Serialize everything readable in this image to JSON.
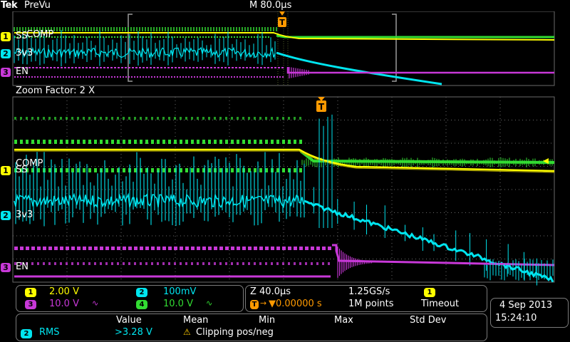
{
  "header": {
    "logo": "Tek",
    "mode": "PreVu",
    "timebase": "M 80.0µs"
  },
  "overview": {
    "channels": [
      {
        "badge": "1",
        "name": "SS",
        "color": "#ffff00"
      },
      {
        "badge": "2",
        "name": "3v3",
        "color": "#00e5ef"
      },
      {
        "badge": "3",
        "name": "EN",
        "color": "#c838d8"
      }
    ],
    "comp_label": "COMP"
  },
  "zoom": {
    "factor_text": "Zoom Factor: 2 X",
    "channels": [
      {
        "badge": "1",
        "name": "SS",
        "color": "#ffff00"
      },
      {
        "badge": "2",
        "name": "3v3",
        "color": "#00e5ef"
      },
      {
        "badge": "3",
        "name": "EN",
        "color": "#c838d8"
      }
    ],
    "comp_label": "COMP",
    "trigger_marker": "T"
  },
  "vertical_settings": {
    "ch1": {
      "badge": "1",
      "scale": "2.00 V"
    },
    "ch2": {
      "badge": "2",
      "scale": "100mV"
    },
    "ch3": {
      "badge": "3",
      "scale": "10.0 V",
      "coupling_icon": "ac-wave-icon"
    },
    "ch4": {
      "badge": "4",
      "scale": "10.0 V",
      "coupling_icon": "ac-wave-icon"
    }
  },
  "horizontal_settings": {
    "zoom_scale": "Z 40.0µs",
    "trigger_position": "▼0.00000 s",
    "sample_rate": "1.25GS/s",
    "record_length": "1M points",
    "trigger_source_badge": "1",
    "trigger_mode": "Timeout"
  },
  "datetime": {
    "date": "4 Sep  2013",
    "time": "15:24:10"
  },
  "measurements": {
    "headers": [
      "Value",
      "Mean",
      "Min",
      "Max",
      "Std Dev"
    ],
    "row": {
      "badge": "2",
      "name": "RMS",
      "value": ">3.28 V",
      "warning": "Clipping pos/neg"
    }
  },
  "colors": {
    "ch1": "#ffff00",
    "ch2": "#00e5ef",
    "ch3": "#c838d8",
    "ch4": "#32dc32",
    "trigger": "#ff9a00",
    "grid": "#6a6a6a"
  }
}
